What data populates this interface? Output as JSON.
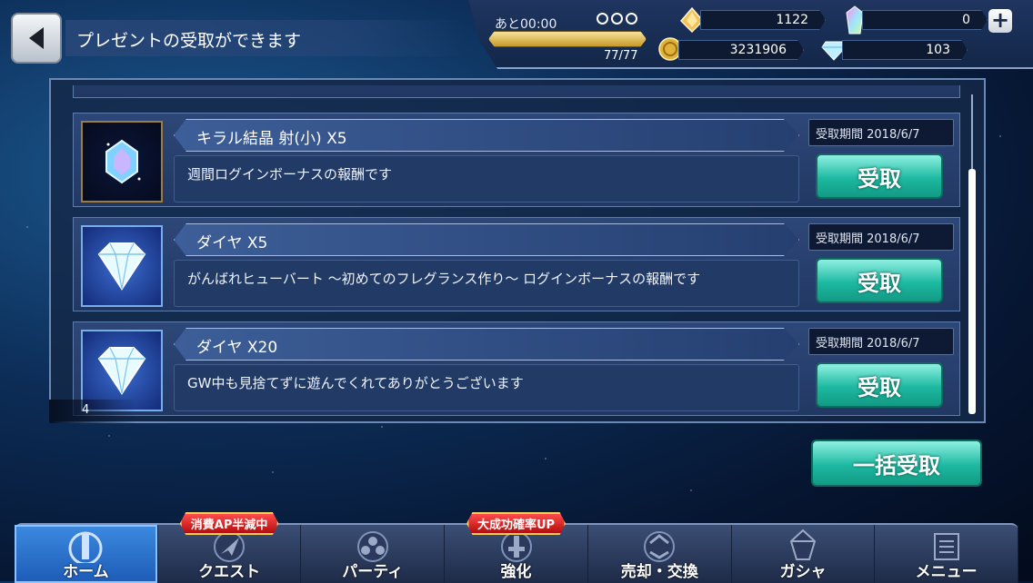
{
  "header": {
    "title": "プレゼントの受取ができます",
    "ap": {
      "timer_label": "あと00:00",
      "current": 77,
      "max": 77,
      "count_text": "77/77",
      "fill_fraction": 1.0
    },
    "resources": {
      "kiral_orb": "1122",
      "paid_crystal": "0",
      "gold": "3231906",
      "diamond": "103"
    }
  },
  "present_list": {
    "items": [
      {
        "name": "キラル結晶 射(小) X5",
        "description": "週間ログインボーナスの報酬です",
        "expiry": "受取期間 2018/6/7",
        "claim_label": "受取",
        "icon": "kiral-crystal-icon"
      },
      {
        "name": "ダイヤ X5",
        "description": "がんばれヒューバート ～初めてのフレグランス作り～ ログインボーナスの報酬です",
        "expiry": "受取期間 2018/6/7",
        "claim_label": "受取",
        "icon": "diamond-icon"
      },
      {
        "name": "ダイヤ X20",
        "description": "GW中も見捨てずに遊んでくれてありがとうございます",
        "expiry": "受取期間 2018/6/7",
        "claim_label": "受取",
        "icon": "diamond-icon"
      }
    ],
    "page_count": "4"
  },
  "bulk_claim_label": "一括受取",
  "nav": {
    "items": [
      {
        "label": "ホーム",
        "icon": "home-tower-icon",
        "active": true,
        "badge": ""
      },
      {
        "label": "クエスト",
        "icon": "quest-arrow-icon",
        "active": false,
        "badge": "消費AP半減中"
      },
      {
        "label": "パーティ",
        "icon": "party-icon",
        "active": false,
        "badge": ""
      },
      {
        "label": "強化",
        "icon": "enhance-icon",
        "active": false,
        "badge": "大成功確率UP"
      },
      {
        "label": "売却・交換",
        "icon": "exchange-icon",
        "active": false,
        "badge": ""
      },
      {
        "label": "ガシャ",
        "icon": "gacha-crystal-icon",
        "active": false,
        "badge": ""
      },
      {
        "label": "メニュー",
        "icon": "menu-book-icon",
        "active": false,
        "badge": ""
      }
    ]
  },
  "colors": {
    "accent_teal": "#1db9a1",
    "ap_gold": "#c79a28",
    "badge_red": "#b30d0d"
  }
}
